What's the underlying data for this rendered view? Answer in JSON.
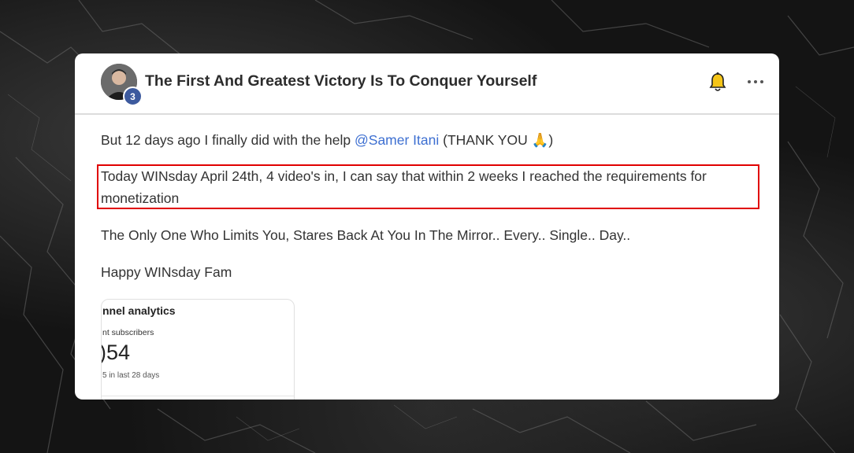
{
  "post": {
    "title": "The First And Greatest Victory Is To Conquer Yourself",
    "author_level": "3",
    "paragraphs": {
      "p1_before": "But 12 days ago I finally did with the help ",
      "p1_mention": "@Samer Itani",
      "p1_after": " (THANK YOU 🙏)",
      "p2_line1": "Today WINsday April 24th, 4 video's in, I can say that within 2 weeks I reached the requirements for",
      "p2_line2": "monetization",
      "p3": "The Only One Who Limits You, Stares Back At You In The Mirror.. Every.. Single.. Day..",
      "p4": "Happy WINsday Fam"
    }
  },
  "attachment": {
    "heading": "nnel analytics",
    "label": "nt subscribers",
    "value": ")54",
    "footnote": "5 in last 28 days"
  },
  "icons": {
    "bell": "bell-icon",
    "more": "more-horizontal-icon"
  },
  "colors": {
    "mention": "#3d6fd1",
    "badge": "#3d5a9e",
    "highlight_border": "#e00000",
    "bell": "#e8b400"
  }
}
